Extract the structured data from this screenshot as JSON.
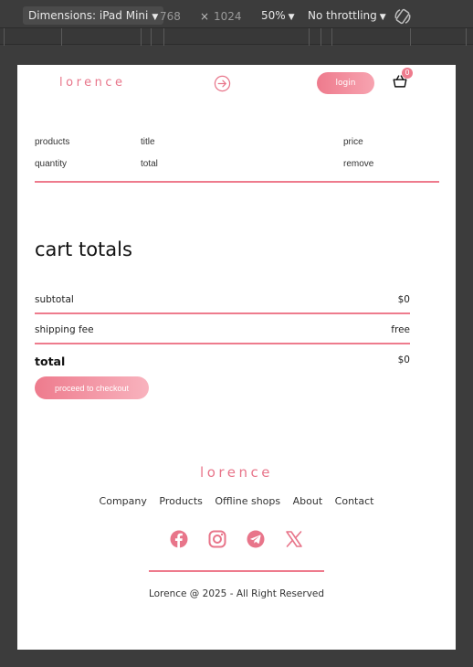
{
  "devtools": {
    "device_label": "Dimensions: iPad Mini",
    "width": "768",
    "times": "×",
    "height": "1024",
    "zoom": "50%",
    "throttling": "No throttling"
  },
  "header": {
    "logo": "lorence",
    "login_label": "login",
    "cart_count": "0"
  },
  "cart_table": {
    "columns": [
      "products",
      "title",
      "price",
      "quantity",
      "total",
      "remove"
    ]
  },
  "cart_totals": {
    "title": "cart totals",
    "subtotal_label": "subtotal",
    "subtotal_value": "$0",
    "shipping_label": "shipping fee",
    "shipping_value": "free",
    "total_label": "total",
    "total_value": "$0",
    "checkout_label": "proceed to checkout"
  },
  "footer": {
    "logo": "lorence",
    "nav": [
      "Company",
      "Products",
      "Offline shops",
      "About",
      "Contact"
    ],
    "social": [
      "facebook-icon",
      "instagram-icon",
      "telegram-icon",
      "x-icon"
    ],
    "copyright": "Lorence @ 2025 - All Right Reserved"
  },
  "colors": {
    "accent": "#ee7b8d",
    "devtools_bg": "#3c3c3c"
  }
}
